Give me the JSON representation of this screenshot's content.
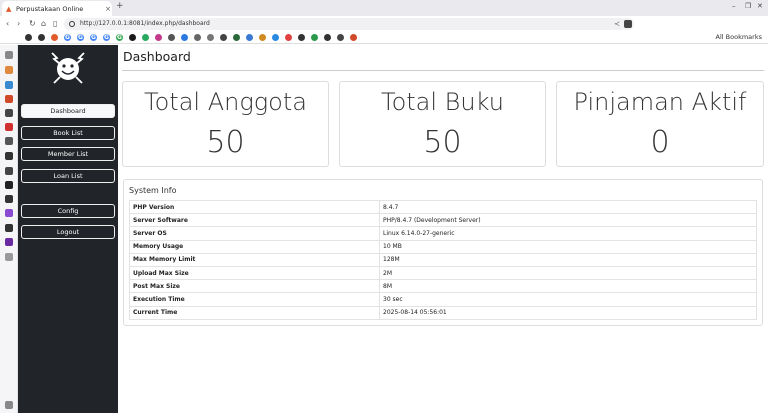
{
  "browser": {
    "tab_title": "Perpustakaan Online",
    "url": "http://127.0.0.1:8081/index.php/dashboard",
    "all_bookmarks": "All Bookmarks"
  },
  "sidebar": {
    "items": [
      {
        "label": "Dashboard",
        "active": true
      },
      {
        "label": "Book List"
      },
      {
        "label": "Member List"
      },
      {
        "label": "Loan List"
      },
      {
        "label": "Config"
      },
      {
        "label": "Logout"
      }
    ]
  },
  "page": {
    "title": "Dashboard"
  },
  "cards": [
    {
      "title": "Total Anggota",
      "value": "50"
    },
    {
      "title": "Total Buku",
      "value": "50"
    },
    {
      "title": "Pinjaman Aktif",
      "value": "0"
    }
  ],
  "system_info": {
    "title": "System Info",
    "rows": [
      {
        "key": "PHP Version",
        "value": "8.4.7"
      },
      {
        "key": "Server Software",
        "value": "PHP/8.4.7 (Development Server)"
      },
      {
        "key": "Server OS",
        "value": "Linux 6.14.0-27-generic"
      },
      {
        "key": "Memory Usage",
        "value": "10 MB"
      },
      {
        "key": "Max Memory Limit",
        "value": "128M"
      },
      {
        "key": "Upload Max Size",
        "value": "2M"
      },
      {
        "key": "Post Max Size",
        "value": "8M"
      },
      {
        "key": "Execution Time",
        "value": "30 sec"
      },
      {
        "key": "Current Time",
        "value": "2025-08-14 05:56:01"
      }
    ]
  }
}
